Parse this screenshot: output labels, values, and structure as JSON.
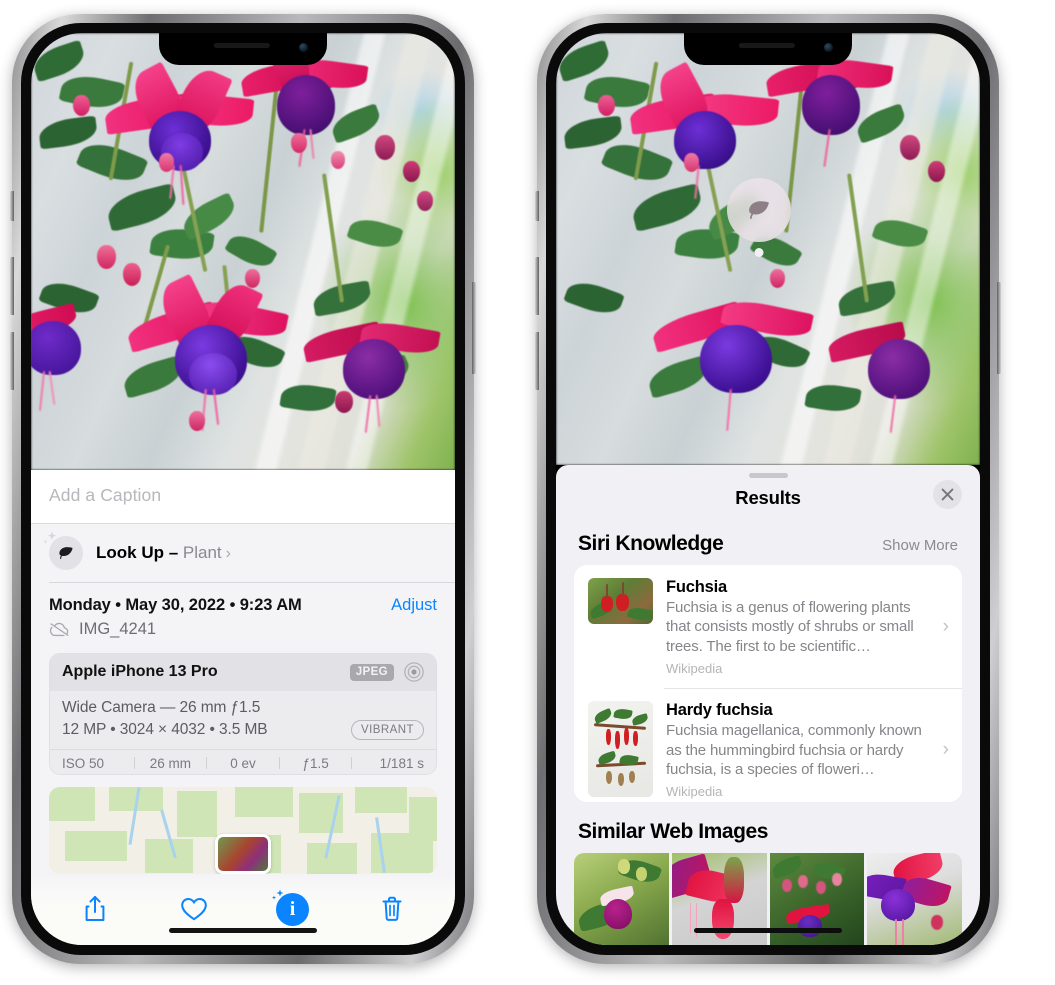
{
  "left_phone": {
    "caption": {
      "placeholder": "Add a Caption",
      "value": ""
    },
    "lookup": {
      "icon": "leaf-icon",
      "label": "Look Up – ",
      "subject": "Plant",
      "chevron": "›"
    },
    "date_row": {
      "date": "Monday • May 30, 2022 • 9:23 AM",
      "adjust_label": "Adjust"
    },
    "file_row": {
      "icon": "icloud-slash-icon",
      "filename": "IMG_4241"
    },
    "camera_card": {
      "model": "Apple iPhone 13 Pro",
      "format_badge": "JPEG",
      "aperture_icon": "aperture-icon",
      "lens": "Wide Camera — 26 mm ƒ1.5",
      "specs": "12 MP • 3024 × 4032 • 3.5 MB",
      "style_badge": "VIBRANT",
      "exif": [
        "ISO 50",
        "26 mm",
        "0 ev",
        "ƒ1.5",
        "1/181 s"
      ]
    },
    "map": {
      "name": "location-map"
    },
    "toolbar": {
      "share": "share-icon",
      "favorite": "heart-icon",
      "info": "info-icon",
      "info_glyph": "i",
      "delete": "trash-icon"
    }
  },
  "right_phone": {
    "photo_badge": {
      "icon": "leaf-icon",
      "name": "visual-lookup-badge"
    },
    "sheet": {
      "title": "Results",
      "close_label": "✕",
      "sections": [
        {
          "title": "Siri Knowledge",
          "action": "Show More",
          "items": [
            {
              "title": "Fuchsia",
              "description": "Fuchsia is a genus of flowering plants that consists mostly of shrubs or small trees. The first to be scientific…",
              "source": "Wikipedia",
              "chevron": "›"
            },
            {
              "title": "Hardy fuchsia",
              "description": "Fuchsia magellanica, commonly known as the hummingbird fuchsia or hardy fuchsia, is a species of floweri…",
              "source": "Wikipedia",
              "chevron": "›"
            }
          ]
        },
        {
          "title": "Similar Web Images",
          "tiles": [
            "web-image-1",
            "web-image-2",
            "web-image-3",
            "web-image-4"
          ]
        }
      ]
    }
  },
  "colors": {
    "accent_blue": "#0a84ff",
    "sheet_bg": "#f1f1f5",
    "info_bg": "#f4f4f7",
    "secondary_text": "#8a8a8f",
    "card_white": "#ffffff"
  }
}
